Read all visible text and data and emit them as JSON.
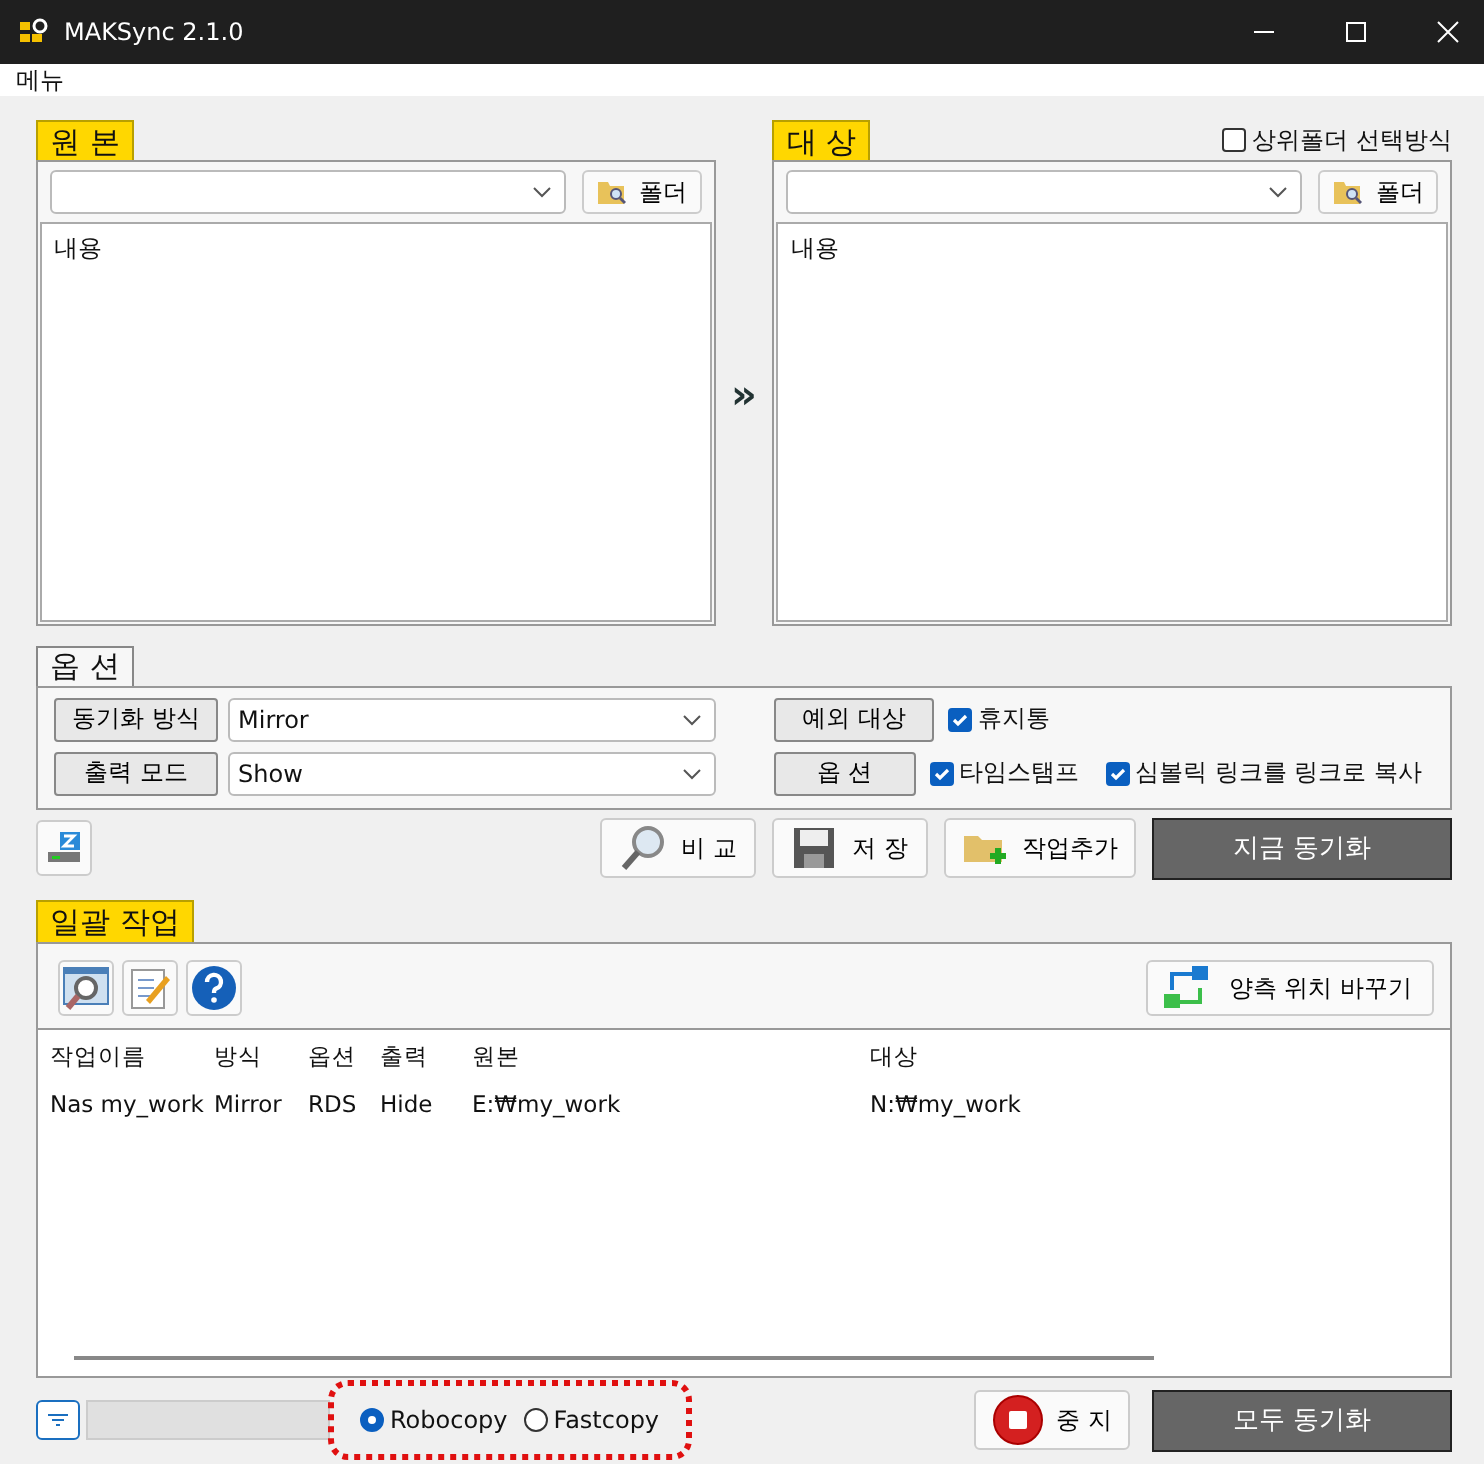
{
  "window": {
    "title": "MAKSync 2.1.0"
  },
  "menu": [
    "메뉴"
  ],
  "source": {
    "label": "원 본",
    "folder_button": "폴더",
    "content": "내용"
  },
  "arrow": "»",
  "target": {
    "label": "대 상",
    "parent_folder_option": {
      "label": "상위폴더 선택방식",
      "checked": false
    },
    "folder_button": "폴더",
    "content": "내용"
  },
  "options": {
    "label": "옵 션",
    "modes": [
      {
        "button": "동기화 방식",
        "value": "Mirror"
      },
      {
        "button": "출력 모드",
        "value": "Show"
      }
    ],
    "rows": [
      {
        "button": "예외 대상",
        "checkboxes": [
          {
            "label": "휴지통",
            "checked": true
          }
        ]
      },
      {
        "button": "옵 션",
        "checkboxes": [
          {
            "label": "타임스탬프",
            "checked": true
          },
          {
            "label": "심볼릭 링크를 링크로 복사",
            "checked": true
          }
        ]
      }
    ]
  },
  "actions": [
    {
      "kind": "compare",
      "label": "비 교"
    },
    {
      "kind": "save",
      "label": "저 장"
    },
    {
      "kind": "add",
      "label": "작업추가"
    }
  ],
  "sync_now": "지금 동기화",
  "batch": {
    "label": "일괄 작업",
    "swap_button": "양측 위치 바꾸기",
    "columns": [
      "작업이름",
      "방식",
      "옵션",
      "출력",
      "원본",
      "대상"
    ],
    "rows": [
      [
        "Nas my_work",
        "Mirror",
        "RDS",
        "Hide",
        "E:₩my_work",
        "N:₩my_work"
      ]
    ]
  },
  "engines": [
    {
      "label": "Robocopy",
      "selected": true
    },
    {
      "label": "Fastcopy",
      "selected": false
    }
  ],
  "progress": {
    "level": 0
  },
  "stop_button": "중 지",
  "sync_all": "모두 동기화"
}
